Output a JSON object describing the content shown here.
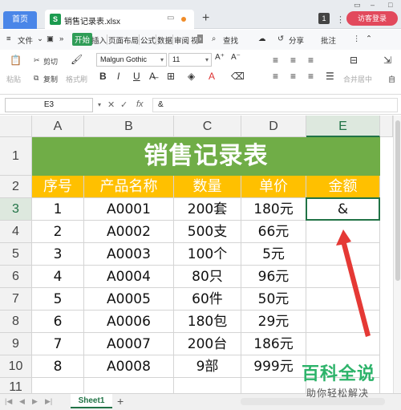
{
  "titlebar": {
    "home_tab": "首页",
    "file_tab": "销售记录表.xlsx",
    "file_icon": "S",
    "tab_count": "1",
    "login_button": "访客登录"
  },
  "menubar": {
    "file_menu": "文件",
    "items": [
      "开始",
      "插入",
      "页面布局",
      "公式",
      "数据",
      "审阅",
      "视"
    ],
    "search": "查找",
    "share": "分享",
    "annotate": "批注"
  },
  "ribbon": {
    "paste": "粘贴",
    "cut": "剪切",
    "copy": "复制",
    "format_painter": "格式刷",
    "font_name": "Malgun Gothic",
    "font_size": "11",
    "merge_center": "合并居中",
    "auto": "自"
  },
  "formula_bar": {
    "cell_ref": "E3",
    "cancel_glyph": "✕",
    "confirm_glyph": "✓",
    "fx_label": "fx",
    "content": "&"
  },
  "grid": {
    "columns": [
      "A",
      "B",
      "C",
      "D",
      "E"
    ],
    "rows": [
      "1",
      "2",
      "3",
      "4",
      "5",
      "6",
      "7",
      "8",
      "9",
      "10",
      "11"
    ],
    "title": "销售记录表",
    "headers": [
      "序号",
      "产品名称",
      "数量",
      "单价",
      "金额"
    ],
    "data": [
      {
        "seq": "1",
        "product": "A0001",
        "qty": "200套",
        "price": "180元",
        "amount": "&"
      },
      {
        "seq": "2",
        "product": "A0002",
        "qty": "500支",
        "price": "66元",
        "amount": ""
      },
      {
        "seq": "3",
        "product": "A0003",
        "qty": "100个",
        "price": "5元",
        "amount": ""
      },
      {
        "seq": "4",
        "product": "A0004",
        "qty": "80只",
        "price": "96元",
        "amount": ""
      },
      {
        "seq": "5",
        "product": "A0005",
        "qty": "60件",
        "price": "50元",
        "amount": ""
      },
      {
        "seq": "6",
        "product": "A0006",
        "qty": "180包",
        "price": "29元",
        "amount": ""
      },
      {
        "seq": "7",
        "product": "A0007",
        "qty": "200台",
        "price": "186元",
        "amount": ""
      },
      {
        "seq": "8",
        "product": "A0008",
        "qty": "9部",
        "price": "999元",
        "amount": ""
      }
    ]
  },
  "sheets": {
    "active": "Sheet1",
    "add": "+"
  },
  "watermark": {
    "main": "百科全说",
    "sub": "助你轻松解决"
  },
  "colors": {
    "title_bg": "#70ad47",
    "header_bg": "#ffc000",
    "selection": "#217346",
    "arrow": "#e53935"
  }
}
